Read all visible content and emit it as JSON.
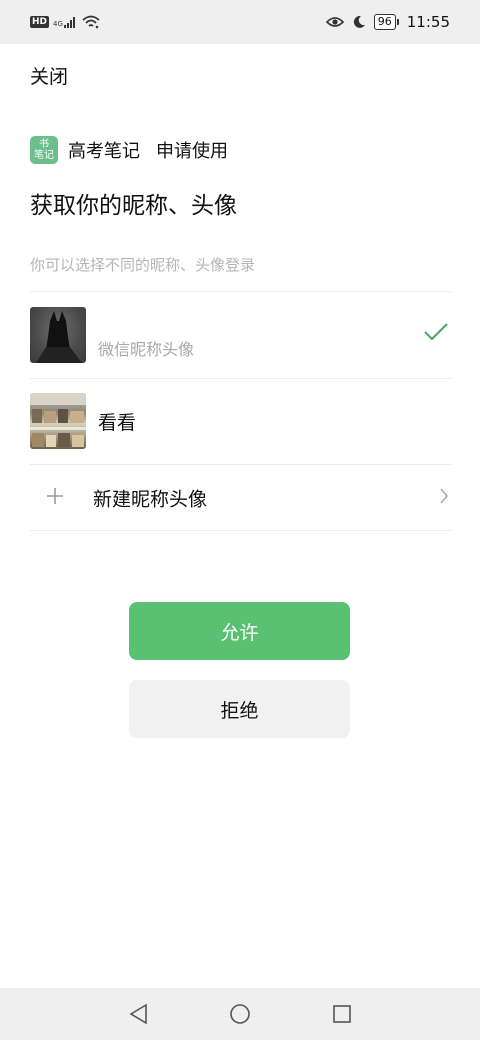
{
  "status_bar": {
    "hd_badge": "HD",
    "network": "4G",
    "battery": "96",
    "time": "11:55",
    "icons": [
      "hd-badge",
      "signal-icon",
      "wifi-icon",
      "eye-icon",
      "moon-icon",
      "battery-icon"
    ]
  },
  "header": {
    "close_label": "关闭"
  },
  "app": {
    "logo_line1": "书",
    "logo_line2": "笔记",
    "name": "高考笔记",
    "request": "申请使用"
  },
  "main": {
    "title": "获取你的昵称、头像",
    "subtitle": "你可以选择不同的昵称、头像登录"
  },
  "options": [
    {
      "label": "微信昵称头像",
      "selected": true
    },
    {
      "label": "看看",
      "selected": false
    }
  ],
  "new_option": {
    "label": "新建昵称头像"
  },
  "buttons": {
    "allow": "允许",
    "deny": "拒绝"
  },
  "colors": {
    "accent": "#5ac172",
    "check": "#4aa35e",
    "app_logo": "#6cbf8a"
  }
}
